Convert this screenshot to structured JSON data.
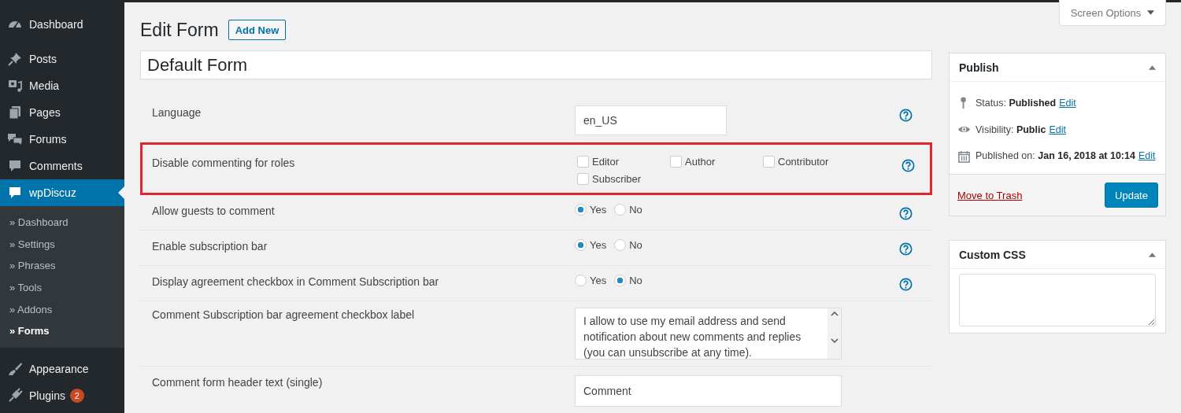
{
  "sidebar": {
    "items": [
      {
        "label": "Dashboard",
        "selected": false
      },
      {
        "label": "Posts",
        "selected": false
      },
      {
        "label": "Media",
        "selected": false
      },
      {
        "label": "Pages",
        "selected": false
      },
      {
        "label": "Forums",
        "selected": false
      },
      {
        "label": "Comments",
        "selected": false
      },
      {
        "label": "wpDiscuz",
        "selected": true,
        "children": [
          {
            "label": "» Dashboard",
            "selected": false
          },
          {
            "label": "» Settings",
            "selected": false
          },
          {
            "label": "» Phrases",
            "selected": false
          },
          {
            "label": "» Tools",
            "selected": false
          },
          {
            "label": "» Addons",
            "selected": false
          },
          {
            "label": "» Forms",
            "selected": true
          }
        ]
      },
      {
        "label": "Appearance",
        "selected": false
      },
      {
        "label": "Plugins",
        "selected": false,
        "badge": "2"
      }
    ]
  },
  "screen_options": "Screen Options",
  "heading": {
    "title": "Edit Form",
    "button": "Add New"
  },
  "form_title": {
    "value": "Default Form"
  },
  "form_rows": [
    {
      "kind": "text",
      "label": "Language",
      "value": "en_US",
      "help": true,
      "highlighted": false
    },
    {
      "kind": "checkboxes",
      "label": "Disable commenting for roles",
      "help": true,
      "highlighted": true,
      "options": [
        {
          "label": "Editor",
          "checked": false
        },
        {
          "label": "Author",
          "checked": false
        },
        {
          "label": "Contributor",
          "checked": false
        },
        {
          "label": "Subscriber",
          "checked": false
        }
      ]
    },
    {
      "kind": "radios",
      "label": "Allow guests to comment",
      "help": true,
      "highlighted": false,
      "options": [
        {
          "label": "Yes",
          "selected": true
        },
        {
          "label": "No",
          "selected": false
        }
      ]
    },
    {
      "kind": "radios",
      "label": "Enable subscription bar",
      "help": true,
      "highlighted": false,
      "options": [
        {
          "label": "Yes",
          "selected": true
        },
        {
          "label": "No",
          "selected": false
        }
      ]
    },
    {
      "kind": "radios",
      "label": "Display agreement checkbox in Comment Subscription bar",
      "help": true,
      "highlighted": false,
      "options": [
        {
          "label": "Yes",
          "selected": false
        },
        {
          "label": "No",
          "selected": true
        }
      ]
    },
    {
      "kind": "textarea",
      "label": "Comment Subscription bar agreement checkbox label",
      "value": "I allow to use my email address and send notification about new comments and replies (you can unsubscribe at any time).",
      "help": false,
      "highlighted": false
    },
    {
      "kind": "text",
      "label": "Comment form header text (single)",
      "value": "Comment",
      "help": false,
      "highlighted": false,
      "wide": true
    }
  ],
  "publish": {
    "title": "Publish",
    "rows": [
      {
        "kind": "status",
        "label": "Status:",
        "value": "Published",
        "link": "Edit"
      },
      {
        "kind": "visibility",
        "label": "Visibility:",
        "value": "Public",
        "link": "Edit"
      },
      {
        "kind": "date",
        "label": "Published on:",
        "value": "Jan 16, 2018 at 10:14",
        "link": "Edit"
      }
    ],
    "trash": "Move to Trash",
    "button": "Update"
  },
  "custom_css": {
    "title": "Custom CSS"
  }
}
